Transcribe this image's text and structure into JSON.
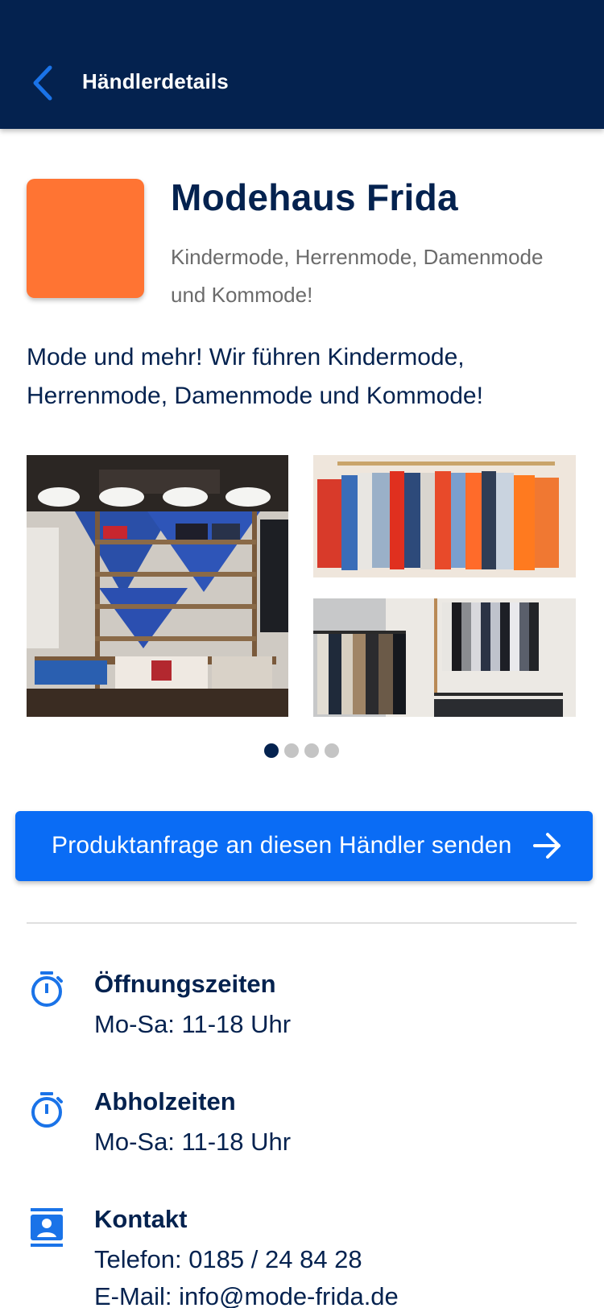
{
  "header": {
    "title": "Händlerdetails",
    "back_icon": "chevron-left-icon"
  },
  "merchant": {
    "name": "Modehaus Frida",
    "tagline": "Kindermode, Herrenmode, Damenmode und Kommode!",
    "description": "Mode und mehr! Wir führen Kindermode, Herrenmode, Damenmode und Kommode!",
    "logo_color": "#ff7433"
  },
  "gallery": {
    "images": [
      "store-interior-photo",
      "clothing-rack-photo",
      "clothing-rail-photo"
    ],
    "page_count": 4,
    "active_page": 1
  },
  "cta": {
    "label": "Produktanfrage an diesen Händler senden",
    "icon": "arrow-right-icon"
  },
  "info": {
    "opening": {
      "title": "Öffnungszeiten",
      "value": "Mo-Sa: 11-18 Uhr",
      "icon": "stopwatch-icon"
    },
    "pickup": {
      "title": "Abholzeiten",
      "value": "Mo-Sa: 11-18 Uhr",
      "icon": "stopwatch-icon"
    },
    "contact": {
      "title": "Kontakt",
      "phone": "Telefon: 0185 / 24 84 28",
      "email": "E-Mail: info@mode-frida.de",
      "icon": "contact-card-icon"
    }
  },
  "colors": {
    "primary_dark": "#04224f",
    "accent_blue": "#0a6cf5",
    "icon_blue": "#1a73e8"
  }
}
